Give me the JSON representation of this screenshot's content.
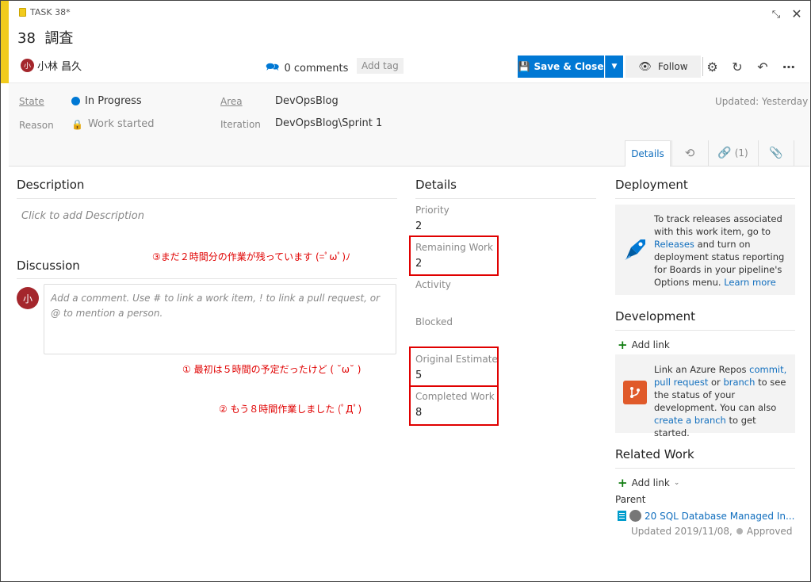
{
  "window": {
    "task_label": "TASK 38*",
    "id": "38",
    "title": "調査"
  },
  "header": {
    "user_name": "小林 昌久",
    "avatar_initial": "小",
    "comments": "0 comments",
    "add_tag": "Add tag",
    "save_close": "Save & Close",
    "follow": "Follow"
  },
  "fields": {
    "state_label": "State",
    "state_value": "In Progress",
    "reason_label": "Reason",
    "reason_value": "Work started",
    "area_label": "Area",
    "area_value": "DevOpsBlog",
    "iteration_label": "Iteration",
    "iteration_value": "DevOpsBlog\\Sprint 1",
    "updated": "Updated: Yesterday"
  },
  "tabs": {
    "details": "Details",
    "links_count": "(1)"
  },
  "description": {
    "title": "Description",
    "placeholder": "Click to add Description"
  },
  "discussion": {
    "title": "Discussion",
    "placeholder": "Add a comment. Use # to link a work item, ! to link a pull request, or @ to mention a person."
  },
  "details": {
    "title": "Details",
    "priority_label": "Priority",
    "priority_value": "2",
    "remaining_label": "Remaining Work",
    "remaining_value": "2",
    "activity_label": "Activity",
    "blocked_label": "Blocked",
    "original_label": "Original Estimate",
    "original_value": "5",
    "completed_label": "Completed Work",
    "completed_value": "8"
  },
  "annotations": {
    "a3": "③まだ２時間分の作業が残っています (=ﾟωﾟ)ﾉ",
    "a1": "① 最初は５時間の予定だったけど ( ˘ω˘ )",
    "a2": "② もう８時間作業しました (ﾟДﾟ)"
  },
  "deployment": {
    "title": "Deployment",
    "text1": "To track releases associated with this work item, go to ",
    "link1": "Releases",
    "text2": " and turn on deployment status reporting for Boards in your pipeline's Options menu. ",
    "link2": "Learn more"
  },
  "development": {
    "title": "Development",
    "add_link": "Add link",
    "t1": "Link an Azure Repos ",
    "l1": "commit,",
    "l2": "pull request",
    "t2": " or ",
    "l3": "branch",
    "t3": " to see the status of your development. You can also ",
    "l4": "create a branch",
    "t4": " to get started."
  },
  "related": {
    "title": "Related Work",
    "add_link": "Add link",
    "parent_label": "Parent",
    "parent_item": "20 SQL Database Managed In...",
    "parent_updated": "Updated 2019/11/08,",
    "parent_state": "Approved"
  },
  "colors": {
    "accent": "#f2cb1d",
    "primary": "#0078d4",
    "in_progress": "#0078d4",
    "annotation": "#e00000",
    "avatar": "#a4262c"
  }
}
